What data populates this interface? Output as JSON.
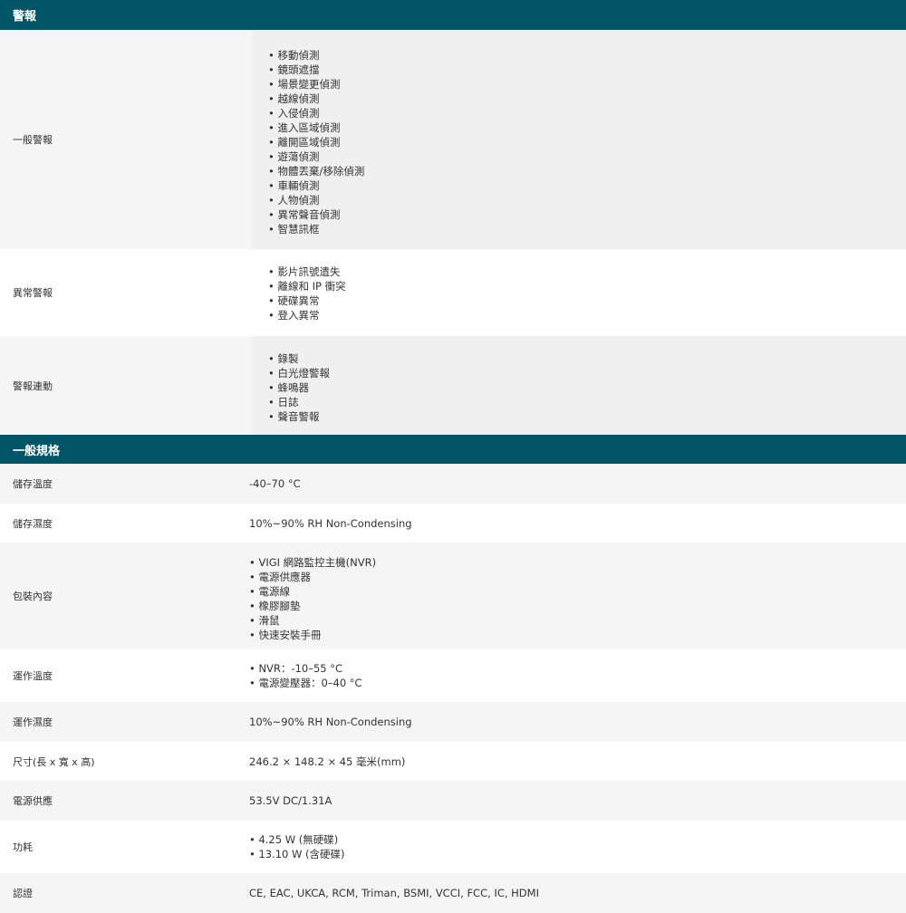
{
  "sections": [
    {
      "title": "警報",
      "rows": [
        {
          "label": "一般警報",
          "items": [
            "移動偵測",
            "鏡頭遮擋",
            "場景變更偵測",
            "越線偵測",
            "入侵偵測",
            "進入區域偵測",
            "離開區域偵測",
            "遊蕩偵測",
            "物體丟棄/移除偵測",
            "車輛偵測",
            "人物偵測",
            "異常聲音偵測",
            "智慧訊框"
          ]
        },
        {
          "label": "異常警報",
          "items": [
            "影片訊號遺失",
            "離線和 IP 衝突",
            "硬碟異常",
            "登入異常"
          ]
        },
        {
          "label": "警報連動",
          "items": [
            "錄製",
            "白光燈警報",
            "蜂鳴器",
            "日誌",
            "聲音警報"
          ]
        }
      ]
    },
    {
      "title": "一般規格",
      "rows": [
        {
          "label": "儲存溫度",
          "value": "-40–70 °C"
        },
        {
          "label": "儲存濕度",
          "value": "10%~90% RH Non-Condensing"
        },
        {
          "label": "包裝內容",
          "items": [
            "VIGI 網路監控主機(NVR)",
            "電源供應器",
            "電源線",
            "橡膠腳墊",
            "滑鼠",
            "快速安裝手冊"
          ]
        },
        {
          "label": "運作溫度",
          "items": [
            "NVR：-10–55 °C",
            "電源變壓器：0–40 °C"
          ]
        },
        {
          "label": "運作濕度",
          "value": "10%~90% RH Non-Condensing"
        },
        {
          "label": "尺寸(長 x 寬 x 高)",
          "value": "246.2 × 148.2 × 45 毫米(mm)"
        },
        {
          "label": "電源供應",
          "value": "53.5V DC/1.31A"
        },
        {
          "label": "功耗",
          "items": [
            "4.25 W (無硬碟)",
            "13.10 W (含硬碟)"
          ]
        },
        {
          "label": "認證",
          "value": "CE, EAC, UKCA, RCM, Triman, BSMI, VCCI, FCC, IC, HDMI"
        }
      ]
    }
  ]
}
